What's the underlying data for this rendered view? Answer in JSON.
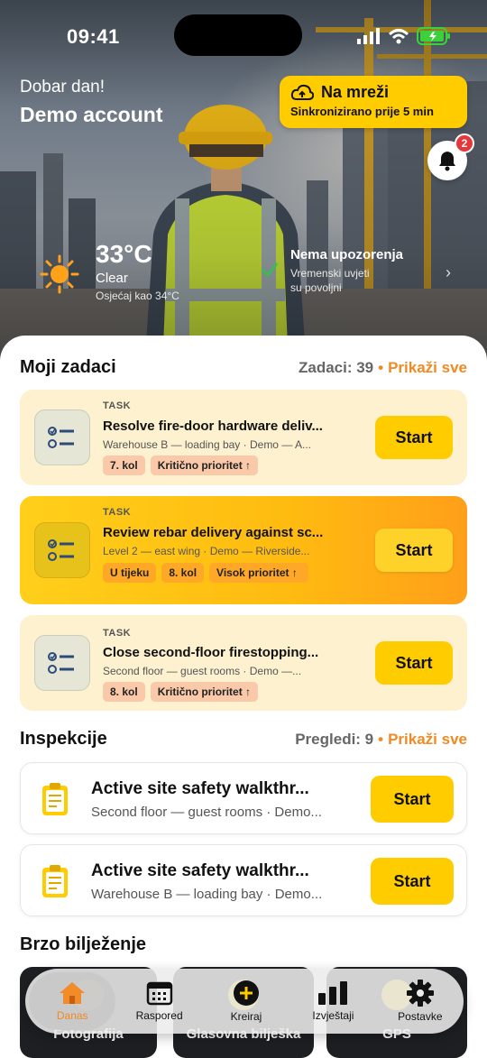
{
  "status_bar": {
    "time": "09:41"
  },
  "header": {
    "greeting": "Dobar dan!",
    "account_name": "Demo account",
    "sync": {
      "title": "Na mreži",
      "subtitle": "Sinkronizirano prije 5 min"
    },
    "notifications": {
      "count": "2"
    }
  },
  "weather": {
    "temperature": "33°C",
    "condition": "Clear",
    "feels_like": "Osjećaj kao 34°C",
    "alert_title": "Nema upozorenja",
    "alert_subtitle_1": "Vremenski uvjeti",
    "alert_subtitle_2": "su povoljni"
  },
  "tasks": {
    "title": "Moji zadaci",
    "count_label": "Zadaci: 39",
    "show_all": "Prikaži sve",
    "items": [
      {
        "kind": "TASK",
        "title": "Resolve fire-door hardware deliv...",
        "subtitle": "Warehouse B — loading bay · Demo — A...",
        "tags": [
          "7. kol",
          "Kritično prioritet ↑"
        ],
        "action": "Start"
      },
      {
        "kind": "TASK",
        "title": "Review rebar delivery against sc...",
        "subtitle": "Level 2 — east wing · Demo — Riverside...",
        "tags": [
          "U tijeku",
          "8. kol",
          "Visok prioritet ↑"
        ],
        "action": "Start"
      },
      {
        "kind": "TASK",
        "title": "Close second-floor firestopping...",
        "subtitle": "Second floor — guest rooms · Demo —...",
        "tags": [
          "8. kol",
          "Kritično prioritet ↑"
        ],
        "action": "Start"
      }
    ]
  },
  "inspections": {
    "title": "Inspekcije",
    "count_label": "Pregledi: 9",
    "show_all": "Prikaži sve",
    "items": [
      {
        "title": "Active site safety walkthr...",
        "subtitle": "Second floor — guest rooms · Demo...",
        "action": "Start"
      },
      {
        "title": "Active site safety walkthr...",
        "subtitle": "Warehouse B — loading bay · Demo...",
        "action": "Start"
      }
    ]
  },
  "quick": {
    "title": "Brzo bilježenje",
    "tiles": [
      "Fotografija",
      "Glasovna bilješka",
      "GPS"
    ]
  },
  "nav": {
    "items": [
      {
        "label": "Danas",
        "icon": "home-icon"
      },
      {
        "label": "Raspored",
        "icon": "calendar-icon"
      },
      {
        "label": "Kreiraj",
        "icon": "plus-circle-icon"
      },
      {
        "label": "Izvještaji",
        "icon": "bar-chart-icon"
      },
      {
        "label": "Postavke",
        "icon": "gear-icon"
      }
    ]
  },
  "colors": {
    "accent": "#ffcc00",
    "link": "#f08a24",
    "badge": "#e5383b"
  }
}
